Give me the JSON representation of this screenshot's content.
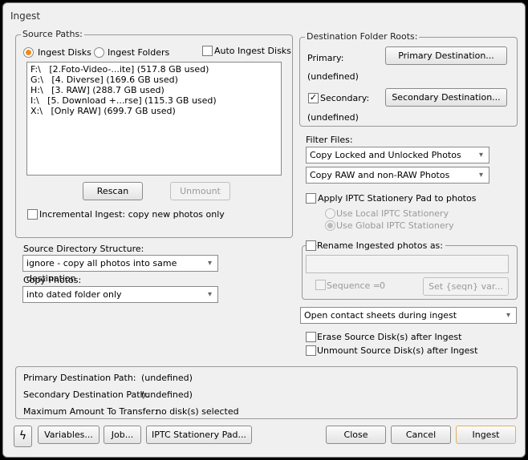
{
  "window": {
    "title": "Ingest"
  },
  "source": {
    "legend": "Source Paths:",
    "ingest_disks": "Ingest Disks",
    "ingest_folders": "Ingest Folders",
    "auto_ingest": "Auto Ingest Disks",
    "disks": [
      "F:\\   [2.Foto-Video-...ite] (517.8 GB used)",
      "G:\\   [4. Diverse] (169.6 GB used)",
      "H:\\   [3. RAW] (288.7 GB used)",
      "I:\\   [5. Download +...rse] (115.3 GB used)",
      "X:\\   [Only RAW] (699.7 GB used)"
    ],
    "rescan": "Rescan",
    "unmount": "Unmount",
    "incremental": "Incremental Ingest: copy new photos only"
  },
  "structure": {
    "label": "Source Directory Structure:",
    "value": "ignore - copy all photos into same destination",
    "copy_label": "Copy Photos:",
    "copy_value": "into dated folder only"
  },
  "dest": {
    "legend": "Destination Folder Roots:",
    "primary_label": "Primary:",
    "primary_button": "Primary Destination...",
    "primary_value": "(undefined)",
    "secondary_label": "Secondary:",
    "secondary_button": "Secondary Destination...",
    "secondary_value": "(undefined)"
  },
  "filter": {
    "label": "Filter Files:",
    "locked": "Copy Locked and Unlocked Photos",
    "raw": "Copy RAW and non-RAW Photos",
    "iptc": "Apply IPTC Stationery Pad to photos",
    "local": "Use Local IPTC Stationery",
    "global": "Use Global IPTC Stationery"
  },
  "rename": {
    "label": "Rename Ingested photos as:",
    "value": "",
    "sequence": "Sequence =",
    "sequence_value": "0",
    "set_button": "Set {seqn} var..."
  },
  "contact": {
    "value": "Open contact sheets during ingest"
  },
  "erase": "Erase Source Disk(s) after Ingest",
  "unmount_after": "Unmount Source Disk(s) after Ingest",
  "summary": {
    "primary_label": "Primary Destination Path:",
    "primary_value": "(undefined)",
    "secondary_label": "Secondary Destination Path:",
    "secondary_value": "(undefined)",
    "max_label": "Maximum Amount To Transfer:",
    "max_value": "no disk(s) selected"
  },
  "footer": {
    "variables": "Variables...",
    "job": "Job...",
    "iptc": "IPTC Stationery Pad...",
    "close": "Close",
    "cancel": "Cancel",
    "ingest": "Ingest"
  },
  "colors": {
    "accent": "#f08a1c"
  }
}
